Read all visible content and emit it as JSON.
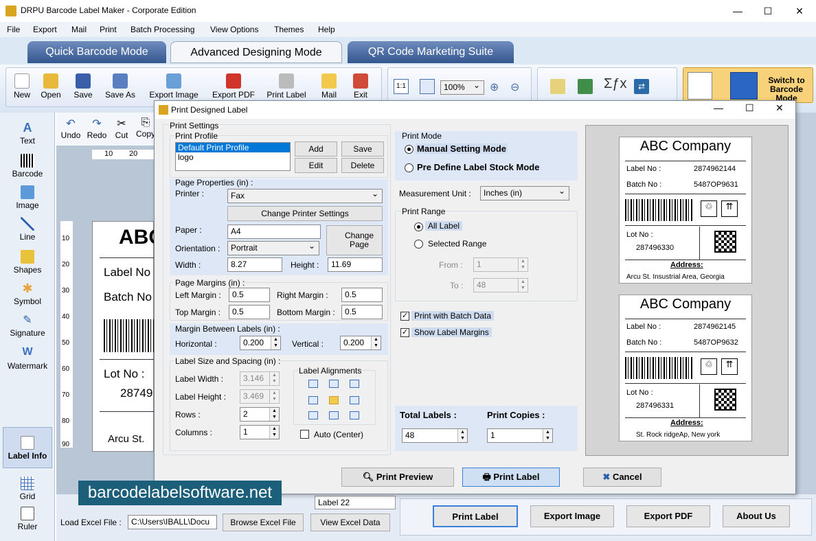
{
  "window": {
    "title": "DRPU Barcode Label Maker - Corporate Edition"
  },
  "menu": [
    "File",
    "Export",
    "Mail",
    "Print",
    "Batch Processing",
    "View Options",
    "Themes",
    "Help"
  ],
  "mode_tabs": [
    "Quick Barcode Mode",
    "Advanced Designing Mode",
    "QR Code Marketing Suite"
  ],
  "toolbar": {
    "buttons": [
      "New",
      "Open",
      "Save",
      "Save As",
      "Export Image",
      "Export PDF",
      "Print Label",
      "Mail",
      "Exit"
    ],
    "zoom": "100%",
    "switch_label": "Switch to Barcode Mode"
  },
  "edit_toolbar": [
    "Undo",
    "Redo",
    "Cut",
    "Copy"
  ],
  "left_tools": [
    "Text",
    "Barcode",
    "Image",
    "Line",
    "Shapes",
    "Symbol",
    "Signature",
    "Watermark",
    "Label Info",
    "Grid",
    "Ruler"
  ],
  "ruler": {
    "h": [
      "10",
      "20"
    ],
    "v": [
      "10",
      "20",
      "30",
      "40",
      "50",
      "60",
      "70",
      "80",
      "90"
    ]
  },
  "canvas_label": {
    "company": "ABC",
    "label_no": "Label No",
    "batch_no": "Batch No",
    "lot_no": "Lot No :",
    "lot_val": "28749",
    "addr": "Arcu St."
  },
  "bottom": {
    "label_combo": "Label 22",
    "load_excel": "Load Excel File :",
    "excel_path": "C:\\Users\\IBALL\\Docu",
    "browse": "Browse Excel File",
    "view": "View Excel Data",
    "print_label": "Print Label",
    "export_image": "Export Image",
    "export_pdf": "Export PDF",
    "about": "About Us"
  },
  "watermark": "barcodelabelsoftware.net",
  "dialog": {
    "title": "Print Designed Label",
    "print_settings": "Print Settings",
    "print_profile": "Print Profile",
    "profiles": [
      "Default Print Profile",
      "logo"
    ],
    "profile_buttons": [
      "Add",
      "Save",
      "Edit",
      "Delete"
    ],
    "page_props": "Page Properties (in) :",
    "printer_lbl": "Printer :",
    "printer_val": "Fax",
    "change_printer": "Change Printer Settings",
    "paper_lbl": "Paper :",
    "paper_val": "A4",
    "change_page": "Change Page",
    "orientation_lbl": "Orientation :",
    "orientation_val": "Portrait",
    "width_lbl": "Width :",
    "width_val": "8.27",
    "height_lbl": "Height :",
    "height_val": "11.69",
    "margins_title": "Page Margins (in) :",
    "left_margin_lbl": "Left Margin :",
    "left_margin": "0.5",
    "right_margin_lbl": "Right Margin :",
    "right_margin": "0.5",
    "top_margin_lbl": "Top Margin :",
    "top_margin": "0.5",
    "bottom_margin_lbl": "Bottom Margin :",
    "bottom_margin": "0.5",
    "between_title": "Margin Between Labels (in) :",
    "horizontal_lbl": "Horizontal :",
    "horizontal": "0.200",
    "vertical_lbl": "Vertical :",
    "vertical": "0.200",
    "size_title": "Label Size and Spacing (in) :",
    "label_width_lbl": "Label Width :",
    "label_width": "3.146",
    "label_height_lbl": "Label Height :",
    "label_height": "3.469",
    "rows_lbl": "Rows :",
    "rows": "2",
    "columns_lbl": "Columns :",
    "columns": "1",
    "alignments_title": "Label Alignments",
    "auto_center": "Auto (Center)",
    "print_mode": "Print Mode",
    "manual_mode": "Manual Setting Mode",
    "predefine_mode": "Pre Define Label Stock Mode",
    "measurement_lbl": "Measurement Unit :",
    "measurement_val": "Inches (in)",
    "print_range": "Print Range",
    "all_label": "All Label",
    "selected_range": "Selected Range",
    "from_lbl": "From :",
    "from_val": "1",
    "to_lbl": "To :",
    "to_val": "48",
    "batch_data": "Print with Batch Data",
    "show_margins": "Show Label Margins",
    "total_labels_lbl": "Total Labels :",
    "total_labels": "48",
    "print_copies_lbl": "Print Copies :",
    "print_copies": "1",
    "print_preview": "Print Preview",
    "print_label": "Print Label",
    "cancel": "Cancel"
  },
  "preview_labels": [
    {
      "company": "ABC Company",
      "label_no_lbl": "Label No :",
      "label_no": "2874962144",
      "batch_no_lbl": "Batch No :",
      "batch_no": "5487OP9631",
      "lot_lbl": "Lot No :",
      "lot": "287496330",
      "addr_lbl": "Address:",
      "addr": "Arcu St. Insustrial Area, Georgia"
    },
    {
      "company": "ABC Company",
      "label_no_lbl": "Label No :",
      "label_no": "2874962145",
      "batch_no_lbl": "Batch No :",
      "batch_no": "5487OP9632",
      "lot_lbl": "Lot No :",
      "lot": "287496331",
      "addr_lbl": "Address:",
      "addr": "St. Rock ridgeAp, New york"
    }
  ]
}
